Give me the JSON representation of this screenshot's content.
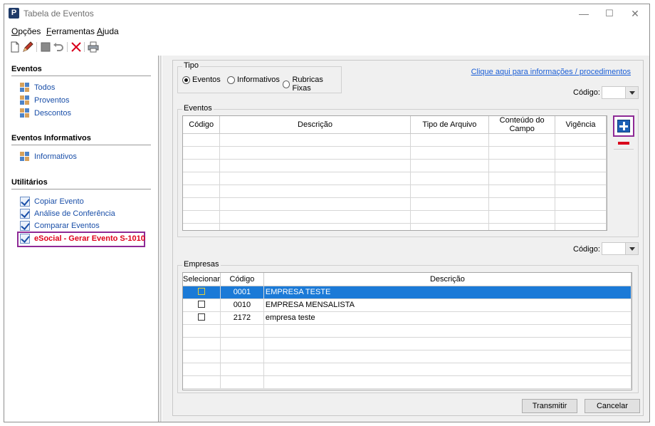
{
  "window": {
    "title": "Tabela de Eventos",
    "icon_letter": "P",
    "minimize": "—",
    "maximize": "☐",
    "close": "✕"
  },
  "menu": [
    {
      "label": "Opções",
      "hotkey": "O",
      "rest": "pções"
    },
    {
      "label": "Ferramentas",
      "hotkey": "F",
      "rest": "erramentas"
    },
    {
      "label": "Ajuda",
      "hotkey": "A",
      "rest": "juda"
    }
  ],
  "toolbar": [
    "new-document-icon",
    "edit-icon",
    "save-icon",
    "undo-icon",
    "delete-icon",
    "print-icon"
  ],
  "sidebar": {
    "eventos": {
      "title": "Eventos",
      "items": [
        "Todos",
        "Proventos",
        "Descontos"
      ]
    },
    "informativos": {
      "title": "Eventos Informativos",
      "items": [
        "Informativos"
      ]
    },
    "utilitarios": {
      "title": "Utilitários",
      "items": [
        "Copiar Evento",
        "Análise de Conferência",
        "Comparar Eventos",
        "eSocial - Gerar Evento S-1010"
      ]
    }
  },
  "tipo": {
    "title": "Tipo",
    "options": [
      "Eventos",
      "Informativos",
      "Rubricas Fixas"
    ],
    "selected": "Eventos"
  },
  "info_link": "Clique aqui para informações / procedimentos",
  "codigo_label": "Código:",
  "eventos_grid": {
    "title": "Eventos",
    "columns": [
      "Código",
      "Descrição",
      "Tipo de Arquivo",
      "Conteúdo do Campo",
      "Vigência"
    ],
    "rows": []
  },
  "empresas_grid": {
    "title": "Empresas",
    "columns": [
      "Selecionar",
      "Código",
      "Descrição"
    ],
    "rows": [
      {
        "codigo": "0001",
        "descricao": "EMPRESA TESTE",
        "selected": true
      },
      {
        "codigo": "0010",
        "descricao": "EMPRESA MENSALISTA",
        "selected": false
      },
      {
        "codigo": "2172",
        "descricao": "empresa teste",
        "selected": false
      }
    ]
  },
  "buttons": {
    "transmitir": "Transmitir",
    "cancelar": "Cancelar"
  },
  "colors": {
    "selection": "#1b7ad7",
    "highlight_border": "#8e2a96",
    "link": "#1a4fa8",
    "danger": "#e0001b"
  }
}
